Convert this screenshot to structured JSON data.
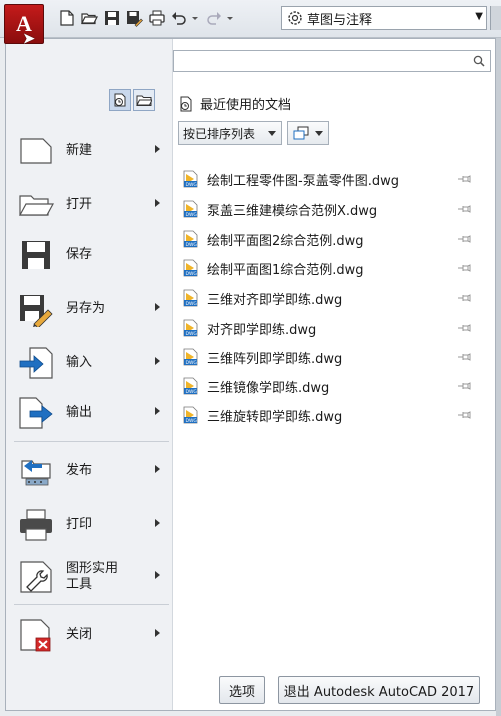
{
  "qat": {
    "app_button_letter": "A",
    "icons": [
      "new-icon",
      "open-icon",
      "save-icon",
      "save-as-icon",
      "plot-icon",
      "undo-icon",
      "redo-icon"
    ],
    "workspace": "草图与注释"
  },
  "search": {
    "placeholder": ""
  },
  "left_menu": {
    "items": [
      {
        "key": "new",
        "label": "新建",
        "has_arrow": true
      },
      {
        "key": "open",
        "label": "打开",
        "has_arrow": true
      },
      {
        "key": "save",
        "label": "保存",
        "has_arrow": false
      },
      {
        "key": "saveas",
        "label": "另存为",
        "has_arrow": true
      },
      {
        "key": "import",
        "label": "输入",
        "has_arrow": true
      },
      {
        "key": "export",
        "label": "输出",
        "has_arrow": true
      },
      {
        "key": "publish",
        "label": "发布",
        "has_arrow": true
      },
      {
        "key": "print",
        "label": "打印",
        "has_arrow": true
      },
      {
        "key": "utilities",
        "label": "图形实用\n工具",
        "has_arrow": true
      },
      {
        "key": "close",
        "label": "关闭",
        "has_arrow": true
      }
    ]
  },
  "recent": {
    "title": "最近使用的文档",
    "sort_label": "按已排序列表",
    "files": [
      "绘制工程零件图-泵盖零件图.dwg",
      "泵盖三维建模综合范例X.dwg",
      "绘制平面图2综合范例.dwg",
      "绘制平面图1综合范例.dwg",
      "三维对齐即学即练.dwg",
      "对齐即学即练.dwg",
      "三维阵列即学即练.dwg",
      "三维镜像学即练.dwg",
      "三维旋转即学即练.dwg"
    ]
  },
  "footer": {
    "options_label": "选项",
    "exit_label": "退出 Autodesk AutoCAD 2017"
  },
  "colors": {
    "app_red": "#b51515",
    "menu_bg": "#eff1f4",
    "accent_blue": "#1f6fc1"
  }
}
